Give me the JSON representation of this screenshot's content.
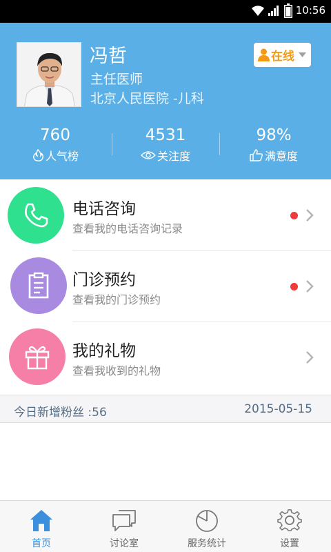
{
  "status_bar": {
    "time": "10:56"
  },
  "doctor": {
    "name": "冯哲",
    "title": "主任医师",
    "hospital": "北京人民医院 -儿科",
    "status": "在线"
  },
  "stats": [
    {
      "value": "760",
      "label": "人气榜",
      "icon": "flame-icon"
    },
    {
      "value": "4531",
      "label": "关注度",
      "icon": "eye-icon"
    },
    {
      "value": "98%",
      "label": "满意度",
      "icon": "thumbs-up-icon"
    }
  ],
  "menu": [
    {
      "title": "电话咨询",
      "subtitle": "查看我的电话咨询记录",
      "icon": "phone-icon",
      "color": "#2fe08f",
      "unread": true
    },
    {
      "title": "门诊预约",
      "subtitle": "查看我的门诊预约",
      "icon": "clipboard-icon",
      "color": "#a88be0",
      "unread": true
    },
    {
      "title": "我的礼物",
      "subtitle": "查看我收到的礼物",
      "icon": "gift-icon",
      "color": "#f67fa8",
      "unread": false
    }
  ],
  "fans": {
    "label": "今日新增粉丝 :56",
    "date": "2015-05-15"
  },
  "tabs": [
    {
      "label": "首页",
      "icon": "home-icon",
      "active": true
    },
    {
      "label": "讨论室",
      "icon": "chat-icon",
      "active": false
    },
    {
      "label": "服务统计",
      "icon": "pie-chart-icon",
      "active": false
    },
    {
      "label": "设置",
      "icon": "gear-icon",
      "active": false
    }
  ],
  "colors": {
    "header_bg": "#5aafe6",
    "status_text": "#f39a14",
    "active_tab": "#3b8fdc",
    "unread_dot": "#ee3a3a"
  }
}
